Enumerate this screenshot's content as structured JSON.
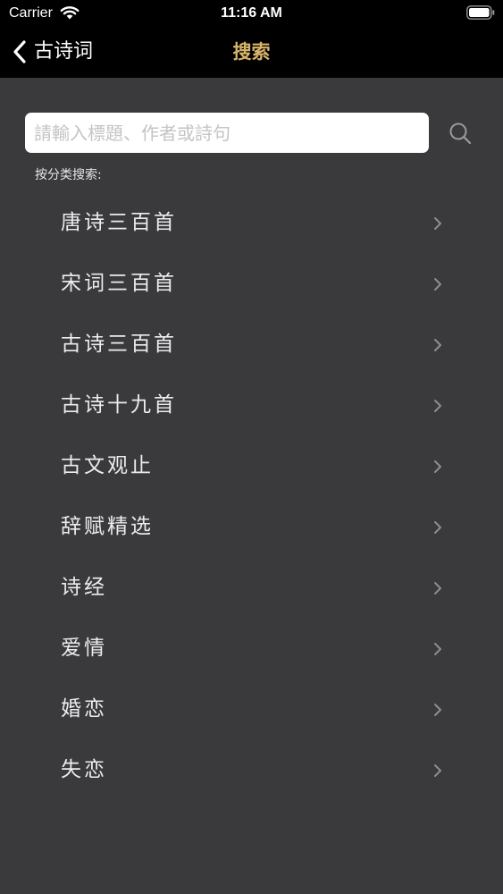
{
  "status_bar": {
    "carrier": "Carrier",
    "time": "11:16 AM"
  },
  "nav": {
    "back_label": "古诗词",
    "title": "搜索"
  },
  "search": {
    "placeholder": "請輸入標題、作者或詩句",
    "value": ""
  },
  "section_label": "按分类搜索:",
  "categories": [
    {
      "label": "唐诗三百首"
    },
    {
      "label": "宋词三百首"
    },
    {
      "label": "古诗三百首"
    },
    {
      "label": "古诗十九首"
    },
    {
      "label": "古文观止"
    },
    {
      "label": "辞赋精选"
    },
    {
      "label": "诗经"
    },
    {
      "label": "爱情"
    },
    {
      "label": "婚恋"
    },
    {
      "label": "失恋"
    }
  ],
  "colors": {
    "nav_background": "#000000",
    "page_background": "#3a393c",
    "title_accent": "#d8b46a",
    "chevron": "#8e8d92"
  }
}
